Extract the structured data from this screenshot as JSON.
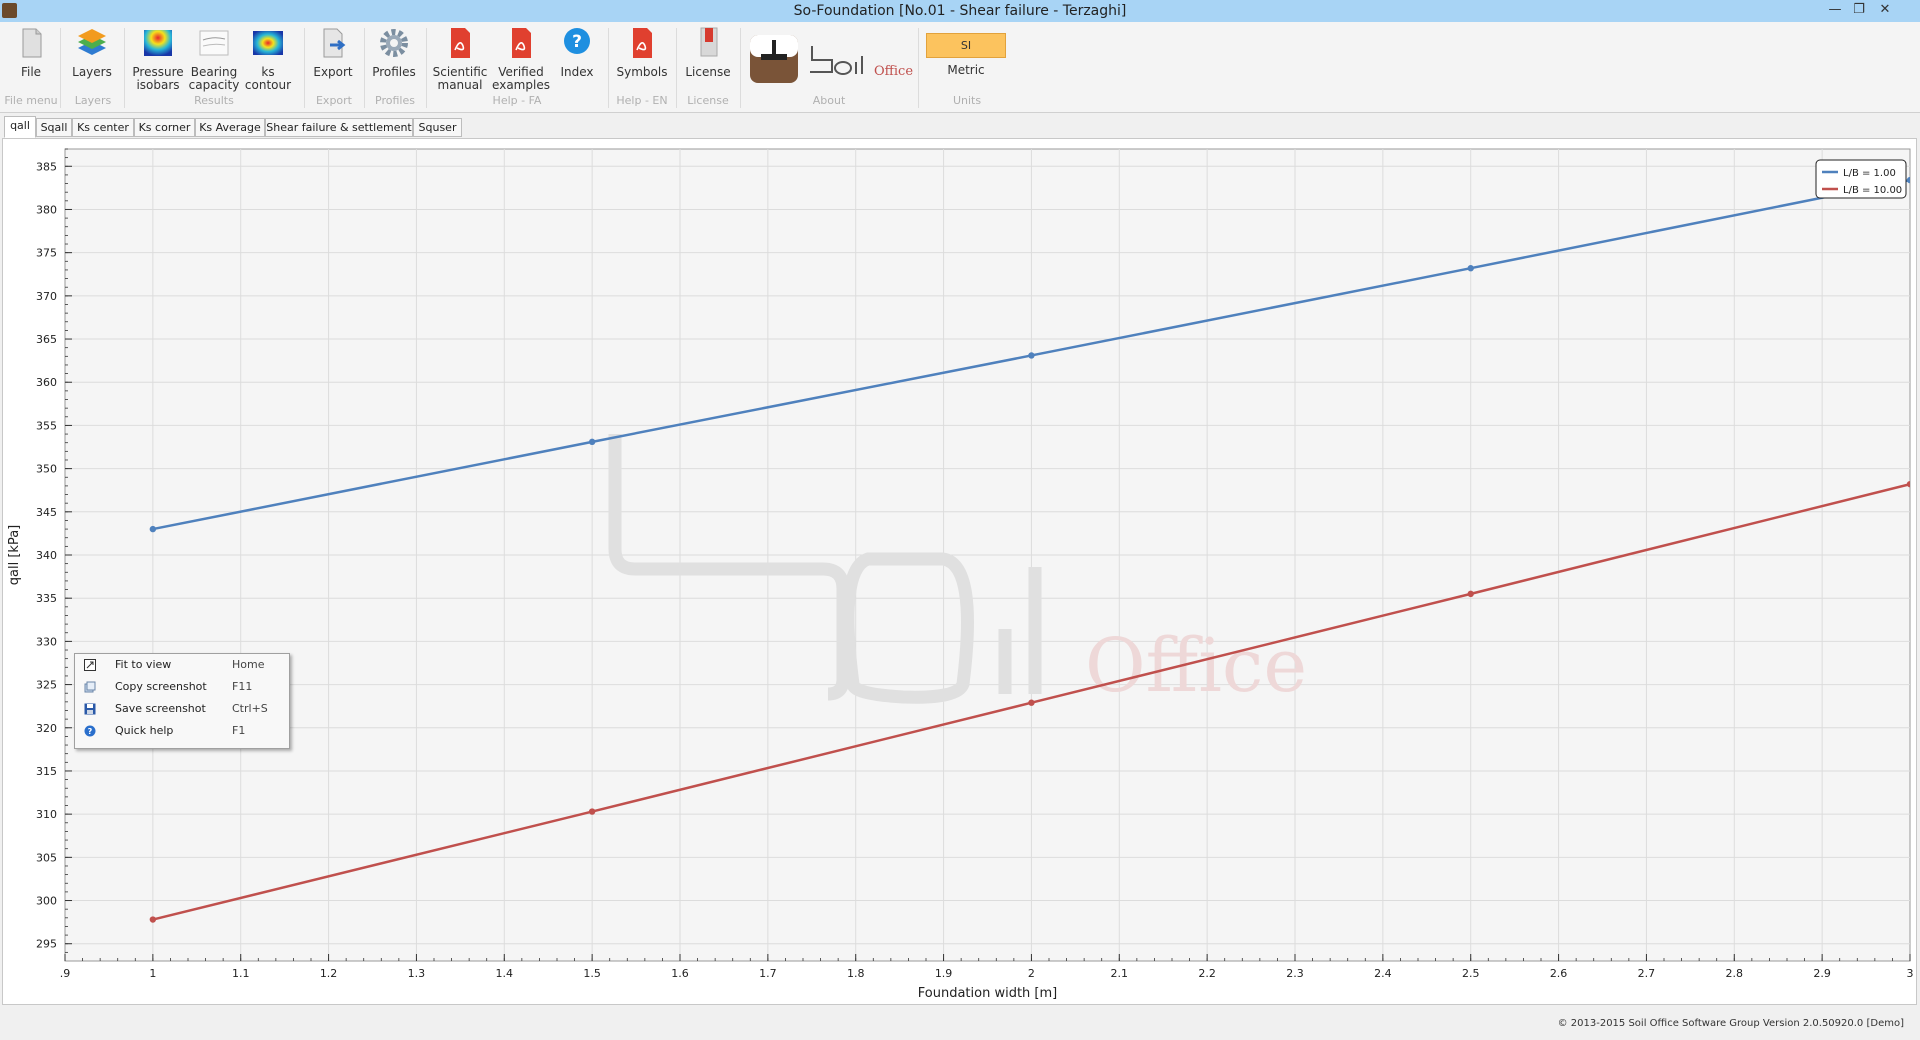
{
  "window": {
    "title": "So-Foundation [No.01 - Shear failure - Terzaghi]"
  },
  "ribbon": {
    "buttons": [
      {
        "line1": "File",
        "line2": ""
      },
      {
        "line1": "Layers",
        "line2": ""
      },
      {
        "line1": "Pressure",
        "line2": "isobars"
      },
      {
        "line1": "Bearing",
        "line2": "capacity"
      },
      {
        "line1": "ks",
        "line2": "contour"
      },
      {
        "line1": "Export",
        "line2": ""
      },
      {
        "line1": "Profiles",
        "line2": ""
      },
      {
        "line1": "Scientific",
        "line2": "manual"
      },
      {
        "line1": "Verified",
        "line2": "examples"
      },
      {
        "line1": "Index",
        "line2": ""
      },
      {
        "line1": "Symbols",
        "line2": ""
      },
      {
        "line1": "License",
        "line2": ""
      }
    ],
    "groups": [
      "File menu",
      "Layers",
      "Results",
      "Export",
      "Profiles",
      "Help - FA",
      "Help - EN",
      "License",
      "About",
      "Units"
    ],
    "units": {
      "badge": "SI",
      "label": "Metric"
    },
    "logo": {
      "text1": "Soil",
      "text2": "Office"
    }
  },
  "tabs": [
    "qall",
    "Sqall",
    "Ks center",
    "Ks corner",
    "Ks Average",
    "Shear failure & settlement",
    "Squser"
  ],
  "colors": {
    "series1": "#4f81bd",
    "series2": "#c0504d",
    "accent_badge": "#fcc35e",
    "titlebar": "#a8d4f5"
  },
  "chart_data": {
    "type": "line",
    "xlabel": "Foundation width [m]",
    "ylabel": "qall [kPa]",
    "xlim": [
      0.9,
      3.0
    ],
    "ylim": [
      293,
      387
    ],
    "xticks": [
      0.9,
      1.0,
      1.1,
      1.2,
      1.3,
      1.4,
      1.5,
      1.6,
      1.7,
      1.8,
      1.9,
      2.0,
      2.1,
      2.2,
      2.3,
      2.4,
      2.5,
      2.6,
      2.7,
      2.8,
      2.9,
      3.0
    ],
    "xticklabels": [
      ".9",
      "1",
      "1.1",
      "1.2",
      "1.3",
      "1.4",
      "1.5",
      "1.6",
      "1.7",
      "1.8",
      "1.9",
      "2",
      "2.1",
      "2.2",
      "2.3",
      "2.4",
      "2.5",
      "2.6",
      "2.7",
      "2.8",
      "2.9",
      "3"
    ],
    "yticks": [
      295,
      300,
      305,
      310,
      315,
      320,
      325,
      330,
      335,
      340,
      345,
      350,
      355,
      360,
      365,
      370,
      375,
      380,
      385
    ],
    "x": [
      1.0,
      1.5,
      2.0,
      2.5,
      3.0
    ],
    "series": [
      {
        "name": "L/B = 1.00",
        "values": [
          343.0,
          353.1,
          363.1,
          373.2,
          383.4
        ]
      },
      {
        "name": "L/B = 10.00",
        "values": [
          297.8,
          310.3,
          322.9,
          335.5,
          348.2
        ]
      }
    ],
    "grid": true,
    "legend": "top-right"
  },
  "context_menu": [
    {
      "label": "Fit to view",
      "shortcut": "Home",
      "icon": "fit-view-icon"
    },
    {
      "label": "Copy screenshot",
      "shortcut": "F11",
      "icon": "copy-screenshot-icon"
    },
    {
      "label": "Save screenshot",
      "shortcut": "Ctrl+S",
      "icon": "save-icon"
    },
    {
      "label": "Quick help",
      "shortcut": "F1",
      "icon": "help-icon"
    }
  ],
  "status": {
    "copyright": "© 2013-2015 Soil Office Software Group   Version 2.0.50920.0 [Demo]"
  }
}
